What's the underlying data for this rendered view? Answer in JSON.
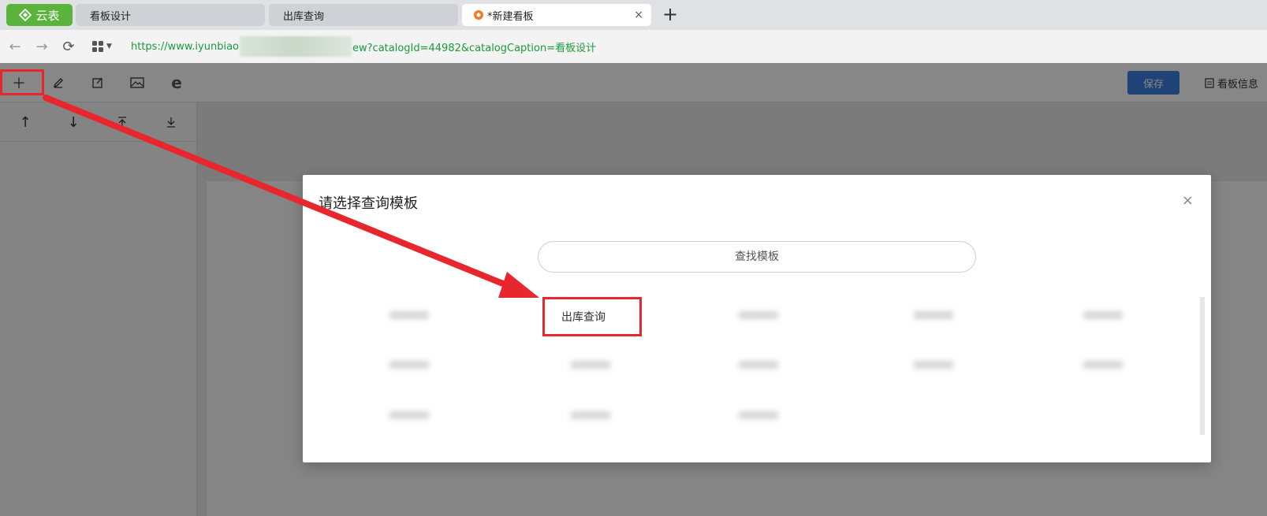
{
  "browser": {
    "brand_tab": "云表",
    "tabs": [
      {
        "label": "看板设计"
      },
      {
        "label": "出库查询"
      },
      {
        "label": "*新建看板",
        "close": "×"
      }
    ],
    "new_tab": "+",
    "url_prefix": "https://www.iyunbiao",
    "url_suffix": "ew?catalogId=44982&catalogCaption=看板设计"
  },
  "toolbar": {
    "save_label": "保存",
    "info_label": "看板信息"
  },
  "modal": {
    "title": "请选择查询模板",
    "close": "×",
    "search_placeholder": "查找模板",
    "items": [
      {
        "label": "出库查询"
      },
      {
        "label": "xxxxxx"
      },
      {
        "label": "xxxxxx"
      },
      {
        "label": "xxxxxx"
      },
      {
        "label": "xxxxxx"
      },
      {
        "label": "xxxxxx"
      },
      {
        "label": "xxxxxx"
      },
      {
        "label": "xxxxxx"
      },
      {
        "label": "xxxxxx"
      },
      {
        "label": "xxxxxx"
      },
      {
        "label": "xxxxxx"
      },
      {
        "label": "xxxxxx"
      },
      {
        "label": "xxxxxx"
      }
    ]
  },
  "colors": {
    "accent_green": "#5ab33a",
    "save_blue": "#3b7de0",
    "annotation_red": "#e8262d",
    "url_green": "#1b9b3a"
  },
  "icons": [
    "plus-icon",
    "pen-icon",
    "edit-icon",
    "image-icon",
    "ie-icon",
    "arrow-up-icon",
    "arrow-down-icon",
    "move-top-icon",
    "move-bottom-icon",
    "close-icon",
    "back-icon",
    "forward-icon",
    "reload-icon",
    "apps-icon",
    "info-doc-icon"
  ]
}
